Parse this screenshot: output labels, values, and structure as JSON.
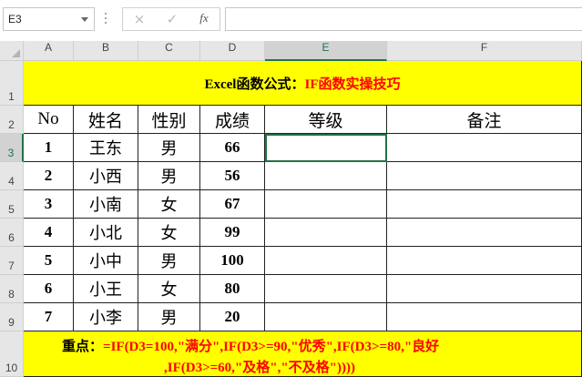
{
  "name_box": {
    "value": "E3"
  },
  "formula_bar": {
    "cancel_icon": "×",
    "enter_icon": "✓",
    "fx_label": "fx",
    "formula": ""
  },
  "columns": [
    "A",
    "B",
    "C",
    "D",
    "E",
    "F"
  ],
  "rows": [
    "1",
    "2",
    "3",
    "4",
    "5",
    "6",
    "7",
    "8",
    "9",
    "10"
  ],
  "title": {
    "prefix": "Excel函数公式：",
    "highlight": "IF函数实操技巧"
  },
  "headers": [
    "No",
    "姓名",
    "性别",
    "成绩",
    "等级",
    "备注"
  ],
  "records": [
    {
      "no": "1",
      "name": "王东",
      "gender": "男",
      "score": "66"
    },
    {
      "no": "2",
      "name": "小西",
      "gender": "男",
      "score": "56"
    },
    {
      "no": "3",
      "name": "小南",
      "gender": "女",
      "score": "67"
    },
    {
      "no": "4",
      "name": "小北",
      "gender": "女",
      "score": "99"
    },
    {
      "no": "5",
      "name": "小中",
      "gender": "男",
      "score": "100"
    },
    {
      "no": "6",
      "name": "小王",
      "gender": "女",
      "score": "80"
    },
    {
      "no": "7",
      "name": "小李",
      "gender": "男",
      "score": "20"
    }
  ],
  "note": {
    "label": "重点：",
    "line1": "=IF(D3=100,\"满分\",IF(D3>=90,\"优秀\",IF(D3>=80,\"良好",
    "line2": ",IF(D3>=60,\"及格\",\"不及格\"))))"
  },
  "selected_cell": "E3",
  "colors": {
    "title_bg": "#ffff00",
    "accent_red": "#ff0000",
    "selection_green": "#217346"
  }
}
